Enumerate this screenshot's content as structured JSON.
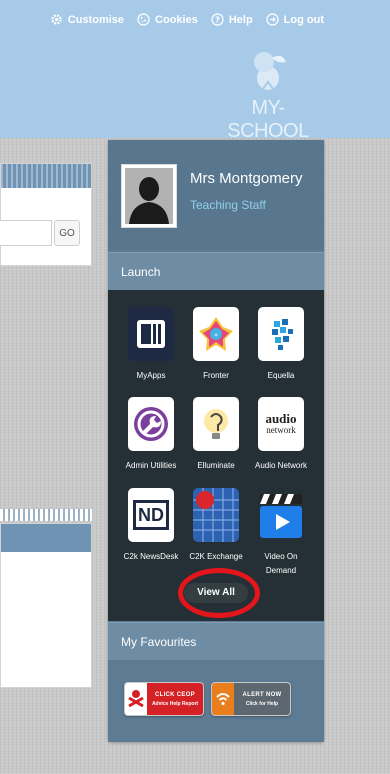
{
  "topbar": {
    "links": [
      {
        "label": "Customise",
        "icon": "gear-icon"
      },
      {
        "label": "Cookies",
        "icon": "cookie-icon"
      },
      {
        "label": "Help",
        "icon": "question-icon"
      },
      {
        "label": "Log out",
        "icon": "logout-icon"
      }
    ]
  },
  "brand": {
    "logo_text": "MY-SCHOOL"
  },
  "search": {
    "go_label": "GO"
  },
  "user": {
    "name": "Mrs Montgomery",
    "role": "Teaching Staff"
  },
  "launch": {
    "title": "Launch",
    "apps": [
      {
        "label": "MyApps",
        "icon": "myapps-icon"
      },
      {
        "label": "Fronter",
        "icon": "fronter-icon"
      },
      {
        "label": "Equella",
        "icon": "equella-icon"
      },
      {
        "label": "Admin Utilities",
        "icon": "wrench-icon"
      },
      {
        "label": "Elluminate",
        "icon": "bulb-ear-icon"
      },
      {
        "label": "Audio Network",
        "icon": "audio-network-logo",
        "logo_line1": "audio",
        "logo_line2": "network"
      },
      {
        "label": "C2k NewsDesk",
        "icon": "newsdesk-icon",
        "logo_text": "ND"
      },
      {
        "label": "C2K Exchange",
        "icon": "exchange-icon"
      },
      {
        "label": "Video On Demand",
        "icon": "clapper-play-icon"
      }
    ],
    "view_all": "View All"
  },
  "favourites": {
    "title": "My Favourites",
    "items": [
      {
        "main": "CLICK CEOP",
        "sub": "Advice Help Report",
        "color": "#d32126",
        "icon": "ceop-icon"
      },
      {
        "main": "ALERT NOW",
        "sub": "Click for Help",
        "color": "#e97e1c",
        "icon": "wifi-alert-icon"
      }
    ]
  },
  "colors": {
    "header_bg": "#a6cae8",
    "panel_bg": "#5d7b92",
    "launch_bg": "#243036",
    "role_text": "#8fd0ea",
    "highlight": "#e4161c"
  }
}
